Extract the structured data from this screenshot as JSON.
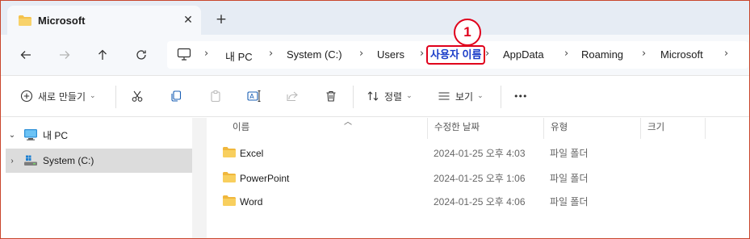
{
  "tab": {
    "title": "Microsoft",
    "close_glyph": "✕",
    "newtab_glyph": "+"
  },
  "nav": {
    "back": "←",
    "forward": "→",
    "up": "↑",
    "refresh": "↻",
    "breadcrumbs": [
      "내 PC",
      "System (C:)",
      "Users",
      "사용자 이름",
      "AppData",
      "Roaming",
      "Microsoft"
    ],
    "separator": "›",
    "highlighted_index": 3,
    "callout_number": "1"
  },
  "toolbar": {
    "new_label": "새로 만들기",
    "sort_label": "정렬",
    "view_label": "보기",
    "more_label": "•••"
  },
  "navpane": {
    "items": [
      {
        "label": "내 PC",
        "chevron": "⌄",
        "icon": "pc-icon"
      },
      {
        "label": "System (C:)",
        "chevron": "›",
        "icon": "drive-icon"
      }
    ]
  },
  "list": {
    "columns": [
      "이름",
      "수정한 날짜",
      "유형",
      "크기"
    ],
    "rows": [
      {
        "name": "Excel",
        "date": "2024-01-25 오후 4:03",
        "type": "파일 폴더"
      },
      {
        "name": "PowerPoint",
        "date": "2024-01-25 오후 1:06",
        "type": "파일 폴더"
      },
      {
        "name": "Word",
        "date": "2024-01-25 오후 4:06",
        "type": "파일 폴더"
      }
    ]
  },
  "colors": {
    "highlight_border": "#e0001b",
    "highlight_text": "#1a3cc8",
    "folder": "#f4c24d"
  }
}
